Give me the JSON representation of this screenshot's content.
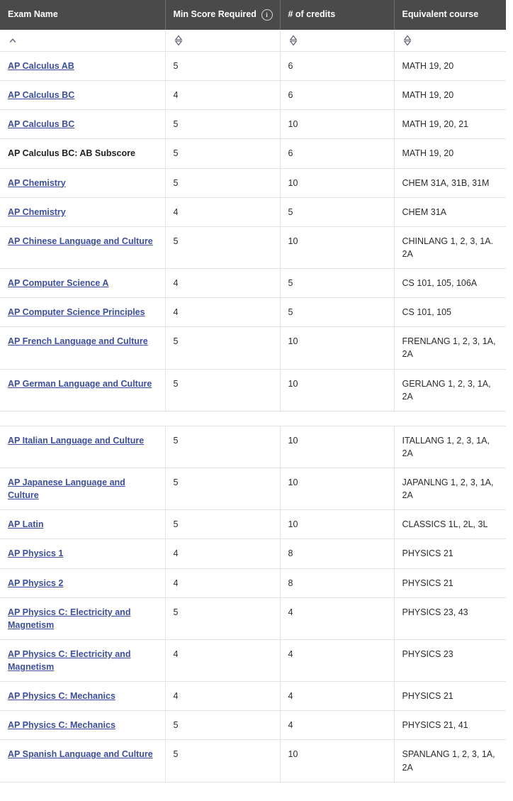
{
  "table": {
    "name": "ap-credit-table",
    "columns": [
      {
        "key": "exam",
        "label": "Exam Name",
        "sort_state": "ascending",
        "sort_icon": "caret-up-icon"
      },
      {
        "key": "minscore",
        "label": "Min Score Required",
        "sort_state": "none",
        "sort_icon": "sort-diamond-icon",
        "info_icon": "info-circle-icon",
        "info_icon_char": "i"
      },
      {
        "key": "credits",
        "label": "# of credits",
        "sort_state": "none",
        "sort_icon": "sort-diamond-icon"
      },
      {
        "key": "equiv",
        "label": "Equivalent course",
        "sort_state": "none",
        "sort_icon": "sort-diamond-icon"
      }
    ],
    "colors": {
      "header_bg": "#4a4a4a",
      "header_text": "#ffffff",
      "link": "#3b4ea0",
      "body_text": "#2b2b2b",
      "row_border": "#e3e3e6",
      "page_bg": "#ffffff"
    },
    "sections": [
      {
        "rows": [
          {
            "exam": "AP Calculus AB",
            "is_link": true,
            "minscore": "5",
            "credits": "6",
            "equiv": "MATH 19, 20"
          },
          {
            "exam": "AP Calculus BC",
            "is_link": true,
            "minscore": "4",
            "credits": "6",
            "equiv": "MATH 19, 20"
          },
          {
            "exam": "AP Calculus BC",
            "is_link": true,
            "minscore": "5",
            "credits": "10",
            "equiv": "MATH 19, 20, 21"
          },
          {
            "exam": "AP Calculus BC: AB Subscore",
            "is_link": false,
            "minscore": "5",
            "credits": "6",
            "equiv": "MATH 19, 20"
          },
          {
            "exam": "AP Chemistry",
            "is_link": true,
            "minscore": "5",
            "credits": "10",
            "equiv": "CHEM 31A, 31B, 31M"
          },
          {
            "exam": "AP Chemistry",
            "is_link": true,
            "minscore": "4",
            "credits": "5",
            "equiv": "CHEM 31A"
          },
          {
            "exam": "AP Chinese Language and Culture",
            "is_link": true,
            "minscore": "5",
            "credits": "10",
            "equiv": "CHINLANG 1, 2, 3, 1A. 2A"
          },
          {
            "exam": "AP Computer Science A",
            "is_link": true,
            "minscore": "4",
            "credits": "5",
            "equiv": "CS 101, 105, 106A"
          },
          {
            "exam": "AP Computer Science Principles",
            "is_link": true,
            "minscore": "4",
            "credits": "5",
            "equiv": "CS 101, 105"
          },
          {
            "exam": "AP French Language and Culture",
            "is_link": true,
            "minscore": "5",
            "credits": "10",
            "equiv": "FRENLANG 1, 2, 3, 1A, 2A"
          },
          {
            "exam": "AP German Language and Culture",
            "is_link": true,
            "minscore": "5",
            "credits": "10",
            "equiv": "GERLANG 1, 2, 3, 1A, 2A"
          }
        ]
      },
      {
        "rows": [
          {
            "exam": "AP Italian Language and Culture",
            "is_link": true,
            "minscore": "5",
            "credits": "10",
            "equiv": "ITALLANG 1, 2, 3, 1A, 2A"
          },
          {
            "exam": "AP Japanese Language and Culture",
            "is_link": true,
            "minscore": "5",
            "credits": "10",
            "equiv": "JAPANLNG 1, 2, 3, 1A, 2A"
          },
          {
            "exam": "AP Latin",
            "is_link": true,
            "minscore": "5",
            "credits": "10",
            "equiv": "CLASSICS 1L, 2L, 3L"
          },
          {
            "exam": "AP Physics 1",
            "is_link": true,
            "minscore": "4",
            "credits": "8",
            "equiv": "PHYSICS 21"
          },
          {
            "exam": "AP Physics 2",
            "is_link": true,
            "minscore": "4",
            "credits": "8",
            "equiv": "PHYSICS 21"
          },
          {
            "exam": "AP Physics C: Electricity and Magnetism",
            "is_link": true,
            "minscore": "5",
            "credits": "4",
            "equiv": "PHYSICS 23, 43"
          },
          {
            "exam": "AP Physics C: Electricity and Magnetism",
            "is_link": true,
            "minscore": "4",
            "credits": "4",
            "equiv": "PHYSICS 23"
          },
          {
            "exam": "AP Physics C: Mechanics",
            "is_link": true,
            "minscore": "4",
            "credits": "4",
            "equiv": "PHYSICS 21"
          },
          {
            "exam": "AP Physics C: Mechanics",
            "is_link": true,
            "minscore": "5",
            "credits": "4",
            "equiv": "PHYSICS 21, 41"
          },
          {
            "exam": "AP Spanish Language and Culture",
            "is_link": true,
            "minscore": "5",
            "credits": "10",
            "equiv": "SPANLANG 1, 2, 3, 1A, 2A"
          }
        ]
      }
    ]
  }
}
